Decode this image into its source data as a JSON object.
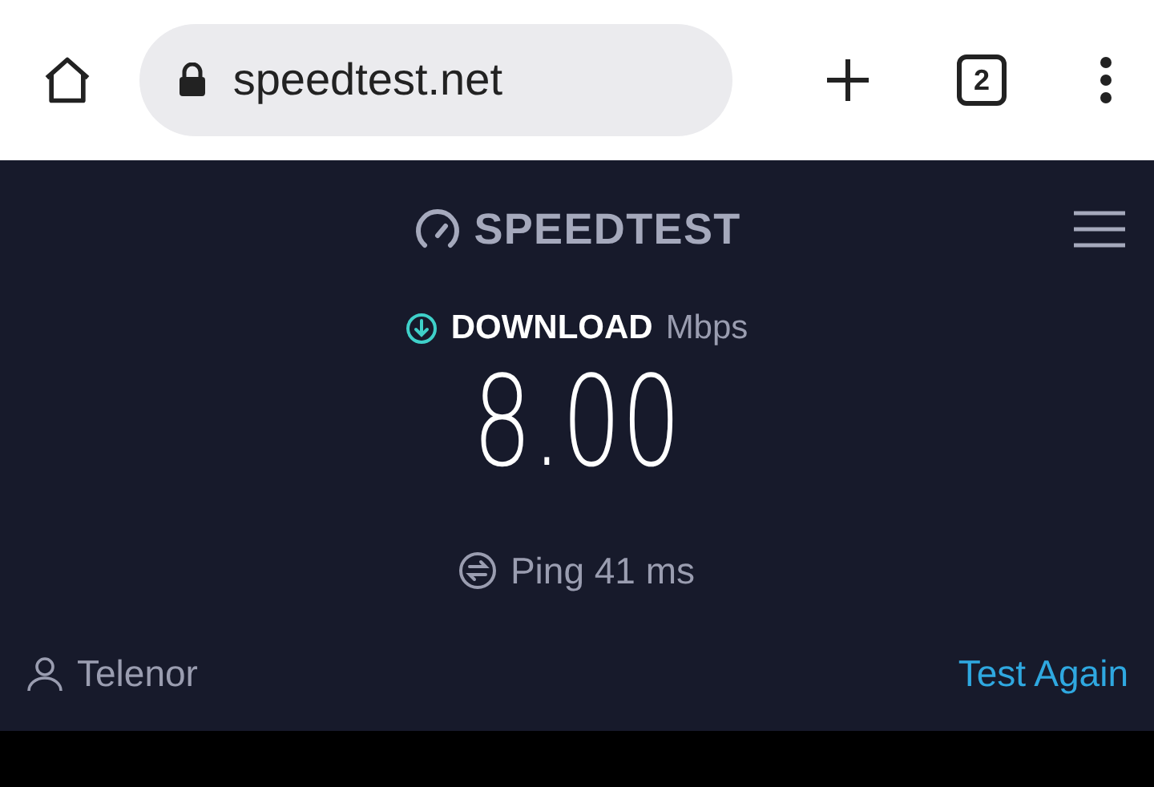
{
  "browser": {
    "url": "speedtest.net",
    "tab_count": "2"
  },
  "header": {
    "logo": "SPEEDTEST"
  },
  "result": {
    "label": "DOWNLOAD",
    "unit": "Mbps",
    "value": "8.00",
    "ping": "Ping 41 ms"
  },
  "footer": {
    "provider": "Telenor",
    "action": "Test Again"
  }
}
